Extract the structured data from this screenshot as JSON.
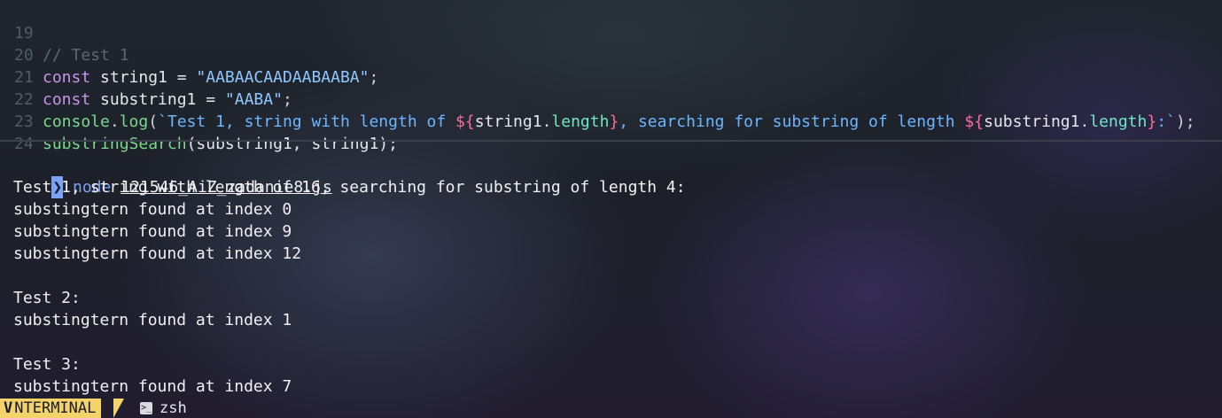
{
  "editor": {
    "lines": [
      {
        "num": "19",
        "comment": "// Test 1"
      },
      {
        "num": "20",
        "kw": "const",
        "name": " string1 = ",
        "str": "\"AABAACAADAABAABA\"",
        "end": ";"
      },
      {
        "num": "21",
        "kw": "const",
        "name": " substring1 = ",
        "str": "\"AABA\"",
        "end": ";"
      },
      {
        "num": "22",
        "obj": "console",
        "dot": ".",
        "method": "log",
        "open": "(",
        "tpl1": "`Test 1, string with length of ",
        "i1o": "${",
        "v1": "string1",
        "dot1": ".",
        "p1": "length",
        "i1c": "}",
        "tpl2": ", searching for substring of length ",
        "i2o": "${",
        "v2": "substring1",
        "dot2": ".",
        "p2": "length",
        "i2c": "}",
        "tpl3": ":`",
        "close": ");"
      },
      {
        "num": "23",
        "fn": "substringSearch",
        "args": "(substring1, string1);"
      },
      {
        "num": "24"
      }
    ]
  },
  "terminal": {
    "prompt_icon": "❯",
    "command": "node",
    "file": "121546_AiZ_zadanie8.js",
    "output": [
      "Test 1, string with length of 16, searching for substring of length 4:",
      "substingtern found at index 0",
      "substingtern found at index 9",
      "substingtern found at index 12",
      "",
      "Test 2:",
      "substingtern found at index 1",
      "",
      "Test 3:",
      "substingtern found at index 7"
    ]
  },
  "statusbar": {
    "active_tab_icon": "V",
    "active_tab_label": "NTERMINAL",
    "shell_icon": ">_",
    "shell_label": "zsh"
  },
  "colors": {
    "prompt_accent": "#7aa2f7",
    "statusbar_accent": "#f5d36b"
  }
}
